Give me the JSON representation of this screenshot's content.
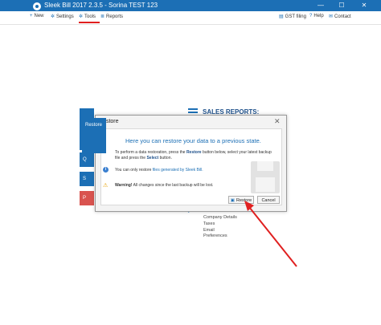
{
  "window": {
    "title": "Sleek Bill 2017 2.3.5 - Sorina TEST 123",
    "minimize": "—",
    "maximize": "☐",
    "close": "✕"
  },
  "menu": {
    "new": "New",
    "settings": "Settings",
    "tools": "Tools",
    "reports": "Reports",
    "gst_filing": "GST filing",
    "help": "Help",
    "contact": "Contact"
  },
  "background": {
    "sales_reports": "SALES REPORTS:",
    "btn_q": "Q",
    "btn_s": "S",
    "btn_p": "P",
    "settings_items": [
      "Company Details",
      "Taxes",
      "Email",
      "Preferences"
    ]
  },
  "dialog": {
    "title": "Restore",
    "tile_label": "Restore",
    "heading": "Here you can restore your data to a previous state.",
    "instr_1": "To perform a data restoration, press the ",
    "instr_restore": "Restore",
    "instr_2": " button below, select your latest backup file and press the ",
    "instr_select": "Select",
    "instr_3": " button.",
    "info_1": "You can only restore ",
    "info_link": "files generated by Sleek Bill.",
    "warn_bold": "Warning!",
    "warn_text": " All changes since the last backup will be lost.",
    "restore_button": "Restore",
    "cancel_button": "Cancel"
  },
  "colors": {
    "accent": "#1c6fb5",
    "annotation": "#e02020"
  }
}
